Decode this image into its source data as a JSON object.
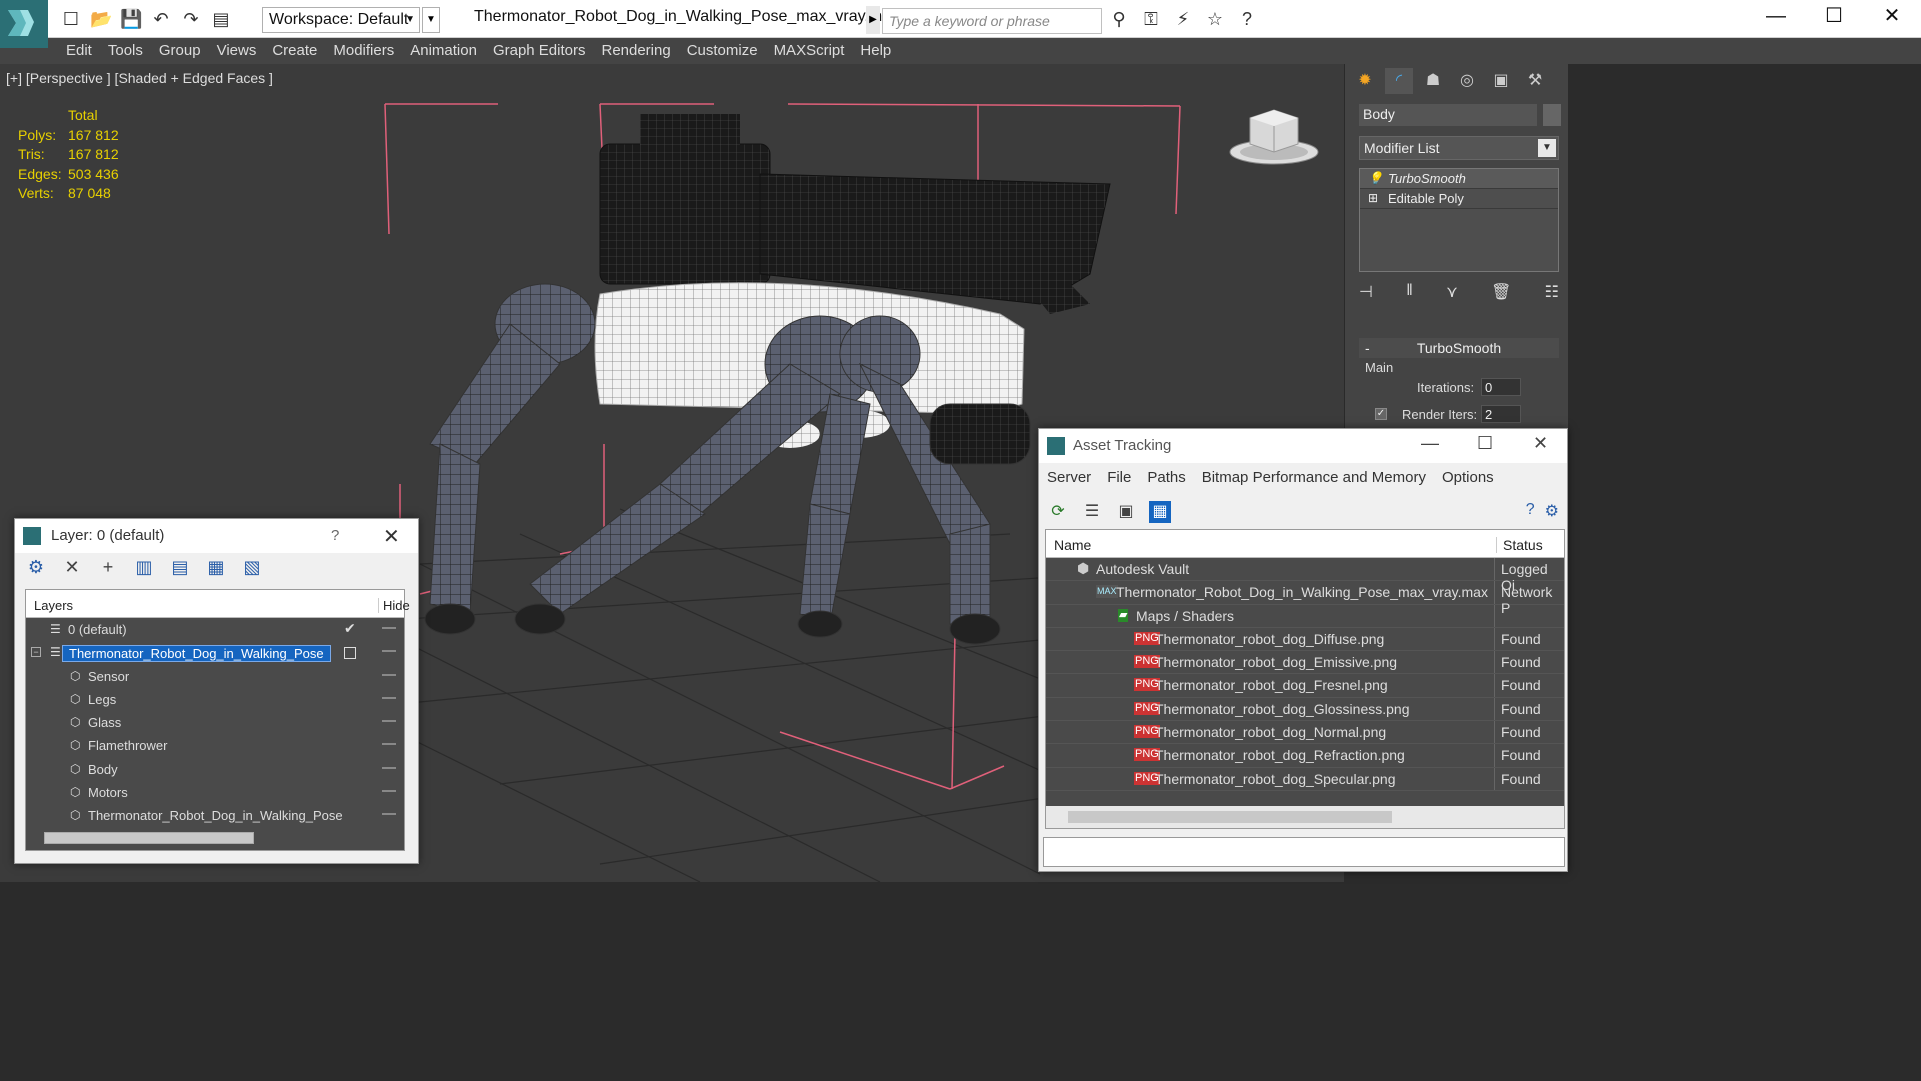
{
  "toolbar": {
    "workspace": "Workspace: Default",
    "doc_title": "Thermonator_Robot_Dog_in_Walking_Pose_max_vray.max",
    "search_placeholder": "Type a keyword or phrase"
  },
  "menu": [
    "Edit",
    "Tools",
    "Group",
    "Views",
    "Create",
    "Modifiers",
    "Animation",
    "Graph Editors",
    "Rendering",
    "Customize",
    "MAXScript",
    "Help"
  ],
  "viewport": {
    "label": "[+] [Perspective ] [Shaded + Edged Faces ]",
    "stats_header": "Total",
    "stats": [
      {
        "k": "Polys:",
        "v": "167 812"
      },
      {
        "k": "Tris:",
        "v": "167 812"
      },
      {
        "k": "Edges:",
        "v": "503 436"
      },
      {
        "k": "Verts:",
        "v": "87 048"
      }
    ]
  },
  "command_panel": {
    "object_name": "Body",
    "modifier_list": "Modifier List",
    "stack": [
      "TurboSmooth",
      "Editable Poly"
    ],
    "rollout": "TurboSmooth",
    "main": "Main",
    "iterations_label": "Iterations:",
    "iterations": "0",
    "render_iters_label": "Render Iters:",
    "render_iters": "2"
  },
  "layer_window": {
    "title": "Layer: 0 (default)",
    "help": "?",
    "col_layers": "Layers",
    "col_hide": "Hide",
    "rows": [
      {
        "name": "0 (default)"
      },
      {
        "name": "Thermonator_Robot_Dog_in_Walking_Pose"
      },
      {
        "name": "Sensor"
      },
      {
        "name": "Legs"
      },
      {
        "name": "Glass"
      },
      {
        "name": "Flamethrower"
      },
      {
        "name": "Body"
      },
      {
        "name": "Motors"
      },
      {
        "name": "Thermonator_Robot_Dog_in_Walking_Pose"
      }
    ]
  },
  "asset_window": {
    "title": "Asset Tracking",
    "menu": [
      "Server",
      "File",
      "Paths",
      "Bitmap Performance and Memory",
      "Options"
    ],
    "col_name": "Name",
    "col_status": "Status",
    "rows": [
      {
        "name": "Autodesk Vault",
        "status": "Logged Oi"
      },
      {
        "name": "Thermonator_Robot_Dog_in_Walking_Pose_max_vray.max",
        "status": "Network P"
      },
      {
        "name": "Maps / Shaders",
        "status": ""
      },
      {
        "name": "Thermonator_robot_dog_Diffuse.png",
        "status": "Found"
      },
      {
        "name": "Thermonator_robot_dog_Emissive.png",
        "status": "Found"
      },
      {
        "name": "Thermonator_robot_dog_Fresnel.png",
        "status": "Found"
      },
      {
        "name": "Thermonator_robot_dog_Glossiness.png",
        "status": "Found"
      },
      {
        "name": "Thermonator_robot_dog_Normal.png",
        "status": "Found"
      },
      {
        "name": "Thermonator_robot_dog_Refraction.png",
        "status": "Found"
      },
      {
        "name": "Thermonator_robot_dog_Specular.png",
        "status": "Found"
      }
    ]
  },
  "colors": {
    "accent": "#1565c0",
    "stats": "#e8d100",
    "brand": "#2b6f75"
  }
}
